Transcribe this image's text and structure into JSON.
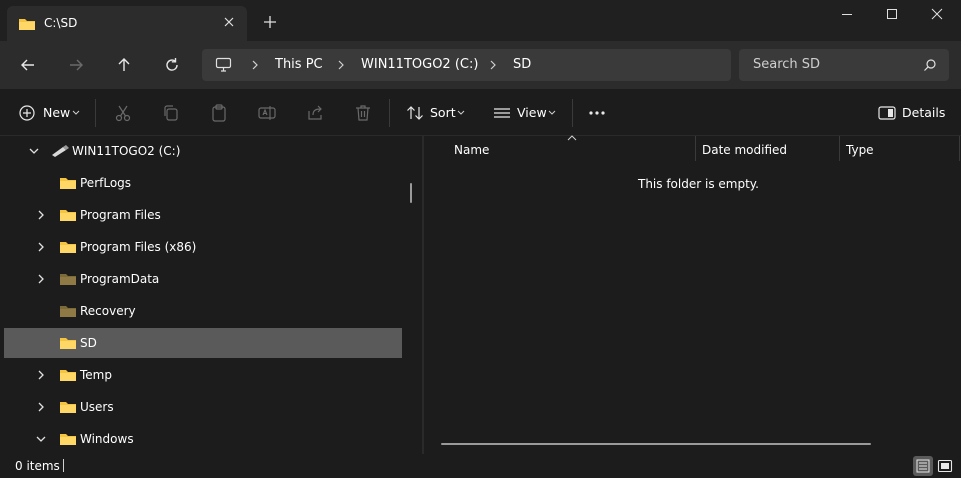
{
  "window": {
    "tab_title": "C:\\SD",
    "accent_folder": "#f5c542"
  },
  "nav": {
    "crumbs": [
      "This PC",
      "WIN11TOGO2 (C:)",
      "SD"
    ],
    "search_placeholder": "Search SD"
  },
  "toolbar": {
    "new_label": "New",
    "sort_label": "Sort",
    "view_label": "View",
    "details_label": "Details"
  },
  "tree": {
    "drive": "WIN11TOGO2 (C:)",
    "items": [
      {
        "label": "PerfLogs",
        "expandable": false,
        "dim": false
      },
      {
        "label": "Program Files",
        "expandable": true,
        "dim": false
      },
      {
        "label": "Program Files (x86)",
        "expandable": true,
        "dim": false
      },
      {
        "label": "ProgramData",
        "expandable": true,
        "dim": true
      },
      {
        "label": "Recovery",
        "expandable": false,
        "dim": true
      },
      {
        "label": "SD",
        "expandable": false,
        "dim": false,
        "selected": true
      },
      {
        "label": "Temp",
        "expandable": true,
        "dim": false
      },
      {
        "label": "Users",
        "expandable": true,
        "dim": false
      },
      {
        "label": "Windows",
        "expandable": true,
        "expanded": true,
        "dim": false
      }
    ]
  },
  "content": {
    "columns": [
      "Name",
      "Date modified",
      "Type"
    ],
    "empty_message": "This folder is empty."
  },
  "status": {
    "item_count": "0 items"
  }
}
